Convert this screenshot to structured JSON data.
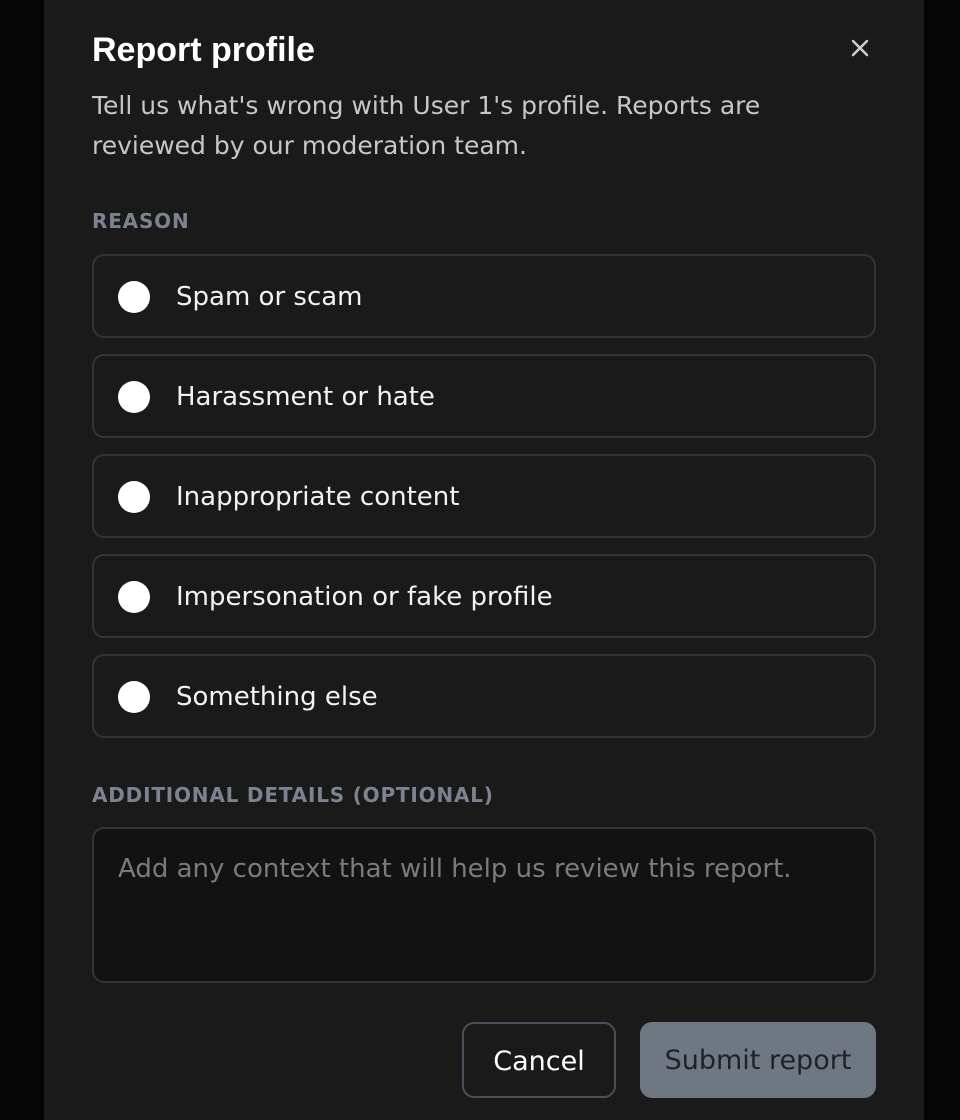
{
  "dialog": {
    "title": "Report profile",
    "description": "Tell us what's wrong with User 1's profile. Reports are reviewed by our moderation team.",
    "reason_label": "REASON",
    "reasons": [
      {
        "label": "Spam or scam"
      },
      {
        "label": "Harassment or hate"
      },
      {
        "label": "Inappropriate content"
      },
      {
        "label": "Impersonation or fake profile"
      },
      {
        "label": "Something else"
      }
    ],
    "details_label": "ADDITIONAL DETAILS (OPTIONAL)",
    "details_placeholder": "Add any context that will help us review this report.",
    "details_value": "",
    "cancel_label": "Cancel",
    "submit_label": "Submit report"
  },
  "icons": {
    "close": "close-icon"
  },
  "colors": {
    "page_background": "#050505",
    "dialog_background": "#1a1a1b",
    "text_primary": "#f2f2f2",
    "text_secondary": "#c7c7c7",
    "section_label": "#7c8390",
    "border": "#343437",
    "radio": "#ffffff",
    "submit_disabled": "#6f7782"
  }
}
